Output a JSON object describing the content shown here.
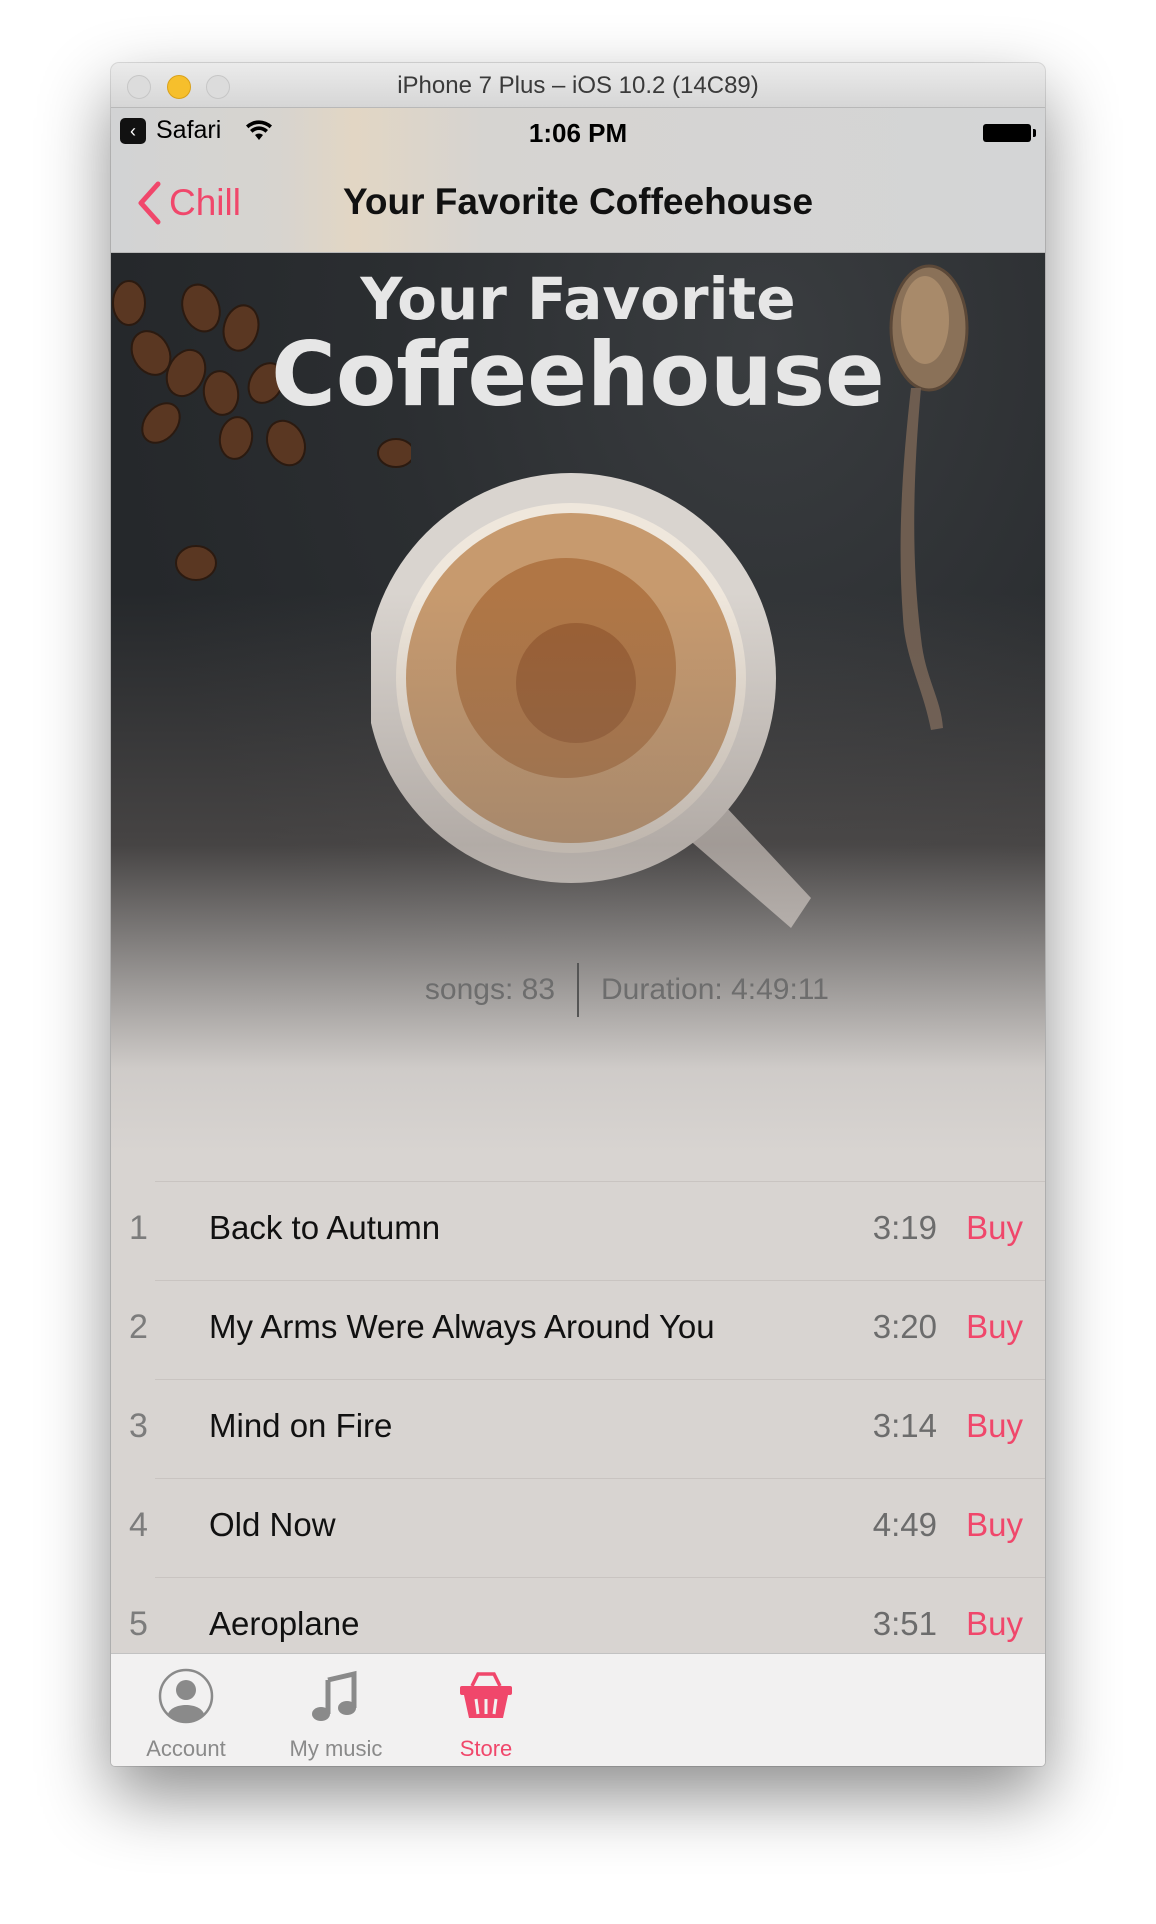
{
  "window": {
    "title": "iPhone 7 Plus – iOS 10.2 (14C89)"
  },
  "status_bar": {
    "back_app": "Safari",
    "time": "1:06 PM"
  },
  "nav": {
    "back_label": "Chill",
    "title": "Your Favorite Coffeehouse"
  },
  "cover": {
    "line1": "Your Favorite",
    "line2": "Coffeehouse"
  },
  "meta": {
    "songs": "songs: 83",
    "duration": "Duration: 4:49:11"
  },
  "tracks": [
    {
      "num": "1",
      "title": "Back to Autumn",
      "duration": "3:19",
      "action": "Buy"
    },
    {
      "num": "2",
      "title": "My Arms Were Always Around You",
      "duration": "3:20",
      "action": "Buy"
    },
    {
      "num": "3",
      "title": "Mind on Fire",
      "duration": "3:14",
      "action": "Buy"
    },
    {
      "num": "4",
      "title": "Old Now",
      "duration": "4:49",
      "action": "Buy"
    },
    {
      "num": "5",
      "title": "Aeroplane",
      "duration": "3:51",
      "action": "Buy"
    }
  ],
  "tabs": [
    {
      "label": "Account",
      "icon": "account-icon",
      "active": false
    },
    {
      "label": "My music",
      "icon": "music-note-icon",
      "active": false
    },
    {
      "label": "Store",
      "icon": "basket-icon",
      "active": true
    }
  ],
  "colors": {
    "accent": "#f0476b",
    "tab_inactive": "#8a8a8a"
  }
}
